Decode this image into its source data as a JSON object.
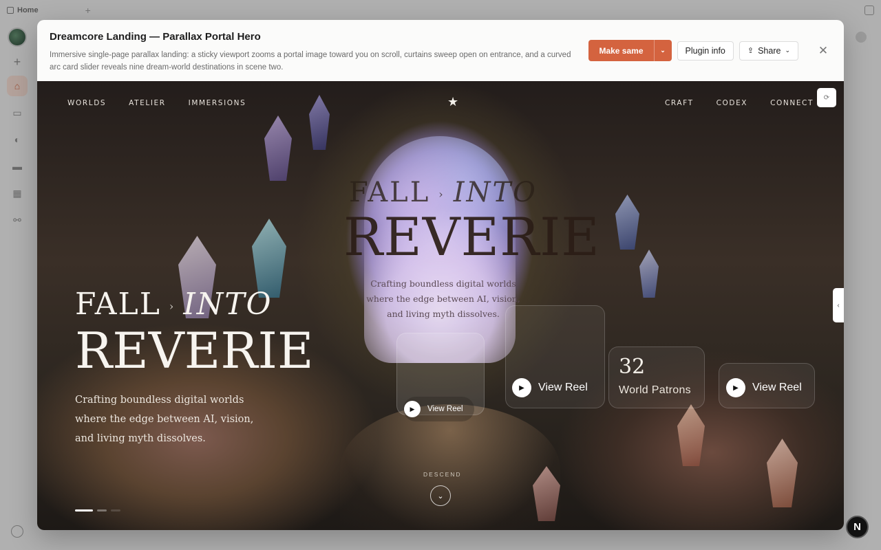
{
  "app": {
    "tab_label": "Home",
    "tab_add": "+"
  },
  "modal": {
    "title": "Dreamcore Landing — Parallax Portal Hero",
    "description": "Immersive single-page parallax landing: a sticky viewport zooms a portal image toward you on scroll, curtains sweep open on entrance, and a curved arc card slider reveals nine dream-world destinations in scene two.",
    "make_same_label": "Make same",
    "plugin_info_label": "Plugin info",
    "share_label": "Share"
  },
  "hero": {
    "nav_left": [
      "WORLDS",
      "ATELIER",
      "IMMERSIONS"
    ],
    "nav_right": [
      "CRAFT",
      "CODEX",
      "CONNECT"
    ],
    "headline_line1_a": "FALL",
    "headline_line1_b": "INTO",
    "headline_line2": "REVERIE",
    "subtitle": "Crafting boundless digital worlds where the edge between AI, vision, and living myth dissolves.",
    "reel_label": "View Reel",
    "stat_number": "32",
    "stat_label": "World Patrons",
    "descend_label": "DESCEND",
    "slide_dots_total": 3,
    "slide_dots_active": 1
  },
  "badge_letter": "N",
  "colors": {
    "accent": "#d4633f",
    "sidebar_active_bg": "#f6dcd2"
  }
}
